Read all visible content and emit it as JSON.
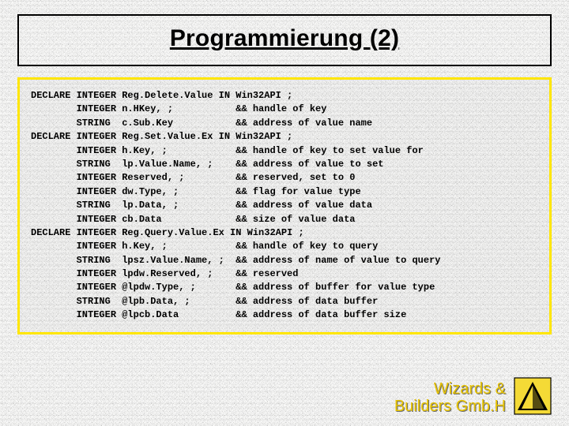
{
  "title": "Programmierung (2)",
  "code_lines": [
    "DECLARE INTEGER Reg.Delete.Value IN Win32API ;",
    "        INTEGER n.HKey, ;           && handle of key",
    "        STRING  c.Sub.Key           && address of value name",
    "DECLARE INTEGER Reg.Set.Value.Ex IN Win32API ;",
    "        INTEGER h.Key, ;            && handle of key to set value for",
    "        STRING  lp.Value.Name, ;    && address of value to set",
    "        INTEGER Reserved, ;         && reserved, set to 0",
    "        INTEGER dw.Type, ;          && flag for value type",
    "        STRING  lp.Data, ;          && address of value data",
    "        INTEGER cb.Data             && size of value data",
    "DECLARE INTEGER Reg.Query.Value.Ex IN Win32API ;",
    "        INTEGER h.Key, ;            && handle of key to query",
    "        STRING  lpsz.Value.Name, ;  && address of name of value to query",
    "        INTEGER lpdw.Reserved, ;    && reserved",
    "        INTEGER @lpdw.Type, ;       && address of buffer for value type",
    "        STRING  @lpb.Data, ;        && address of data buffer",
    "        INTEGER @lpcb.Data          && address of data buffer size"
  ],
  "footer": {
    "line1": "Wizards &",
    "line2": "Builders Gmb.H"
  },
  "colors": {
    "code_border": "#ffe600",
    "footer_text": "#e6c200"
  }
}
